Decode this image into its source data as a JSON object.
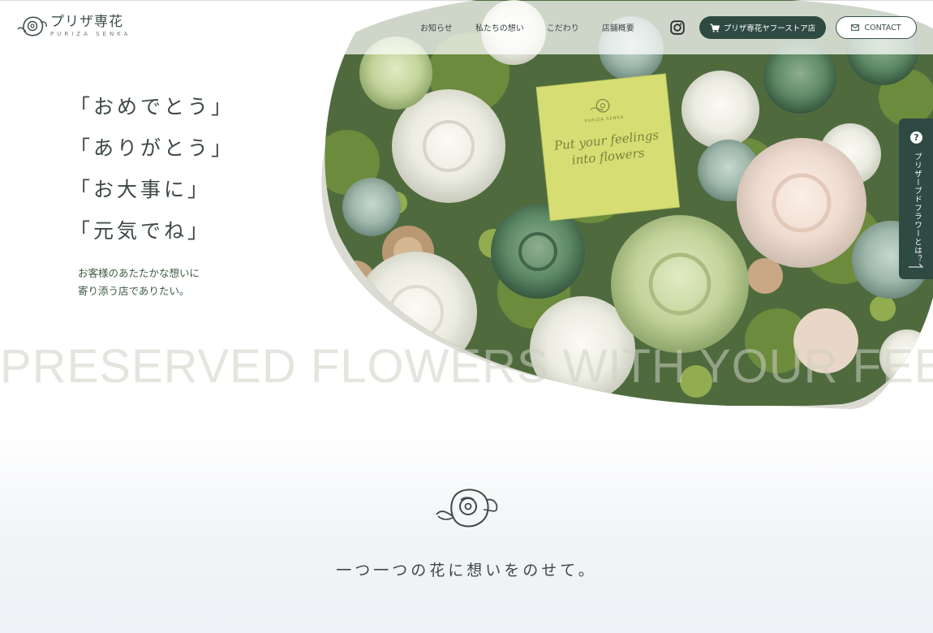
{
  "header": {
    "logo_jp": "プリザ専花",
    "logo_en": "PURIZA SENKA",
    "nav": [
      "お知らせ",
      "私たちの想い",
      "こだわり",
      "店舗概要"
    ],
    "store_button": "プリザ専花ヤフーストア店",
    "contact_button": "CONTACT"
  },
  "hero": {
    "catch_lines": [
      "「おめでとう」",
      "「ありがとう」",
      "「お大事に」",
      "「元気でね」"
    ],
    "sub_lines": [
      "お客様のあたたかな想いに",
      "寄り添う店でありたい。"
    ],
    "card_brand": "PURIZA SENKA",
    "card_lines": [
      "Put your feelings",
      "into flowers"
    ],
    "marquee": "PRESERVED FLOWERS WITH YOUR FEE"
  },
  "side_tab": {
    "icon": "?",
    "label": "プリザーブドフラワーとは？"
  },
  "section": {
    "title": "一つ一つの花に想いをのせて。"
  },
  "colors": {
    "accent": "#2f4a43",
    "text": "#3d4944",
    "sub_text": "#3b5a3e",
    "card": "#d6dd72",
    "hero_shadow": "#dcdbd3"
  }
}
